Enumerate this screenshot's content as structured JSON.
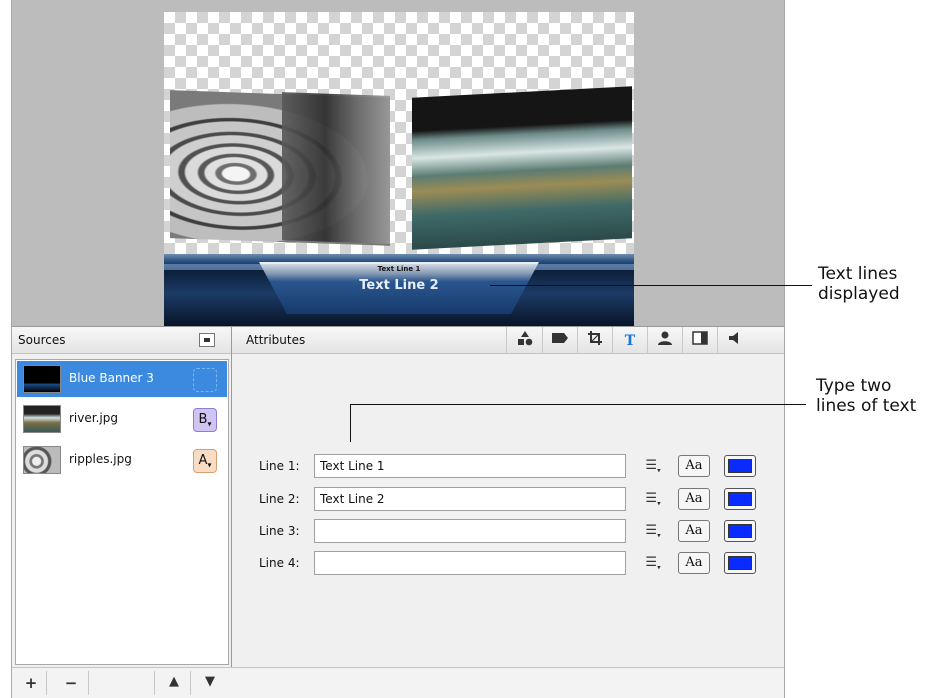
{
  "preview": {
    "banner_line1": "Text Line 1",
    "banner_line2": "Text Line 2"
  },
  "sources": {
    "title": "Sources",
    "items": [
      {
        "name": "Blue Banner 3",
        "badge": "",
        "selected": true
      },
      {
        "name": "river.jpg",
        "badge": "B",
        "selected": false
      },
      {
        "name": "ripples.jpg",
        "badge": "A",
        "selected": false
      }
    ],
    "footer": {
      "add": "+",
      "remove": "−",
      "up": "🡅",
      "down": "🡇"
    }
  },
  "attributes": {
    "title": "Attributes",
    "tools": [
      "shapes-icon",
      "tag-icon",
      "crop-icon",
      "text-icon",
      "person-icon",
      "panel-icon",
      "speaker-icon"
    ],
    "text_tool_glyph": "T",
    "lines": [
      {
        "label": "Line 1:",
        "value": "Text Line 1"
      },
      {
        "label": "Line 2:",
        "value": "Text Line 2"
      },
      {
        "label": "Line 3:",
        "value": ""
      },
      {
        "label": "Line 4:",
        "value": ""
      }
    ],
    "font_button": "Aa",
    "text_color": "#0a2bff"
  },
  "callouts": {
    "displayed_1": "Text lines",
    "displayed_2": "displayed",
    "type_1": "Type two",
    "type_2": "lines of text"
  }
}
